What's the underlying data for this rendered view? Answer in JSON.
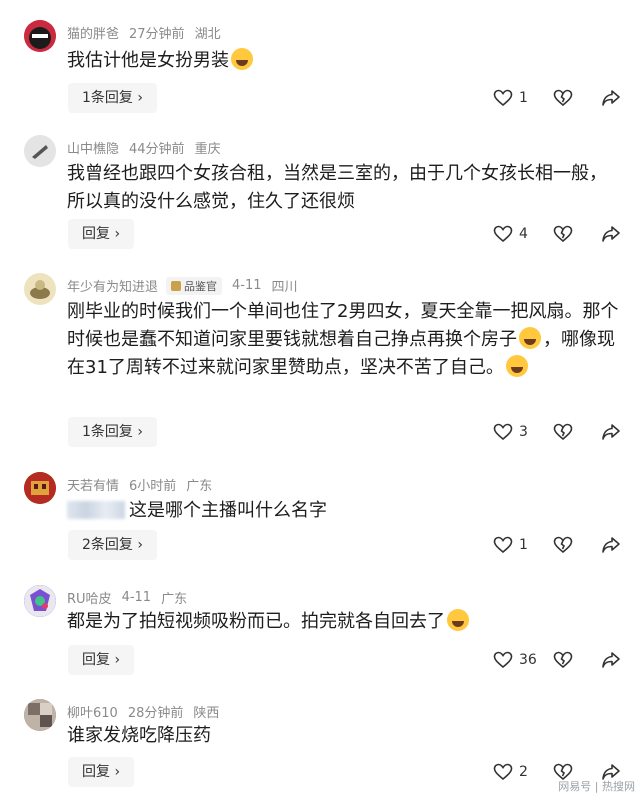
{
  "comments": [
    {
      "user": "猫的胖爸",
      "time": "27分钟前",
      "location": "湖北",
      "text": "我估计他是女扮男装",
      "emoji_after": true,
      "reply_label": "1条回复 ›",
      "likes": "1"
    },
    {
      "user": "山中樵隐",
      "time": "44分钟前",
      "location": "重庆",
      "text": "我曾经也跟四个女孩合租，当然是三室的，由于几个女孩长相一般，所以真的没什么感觉，住久了还很烦",
      "reply_label": "回复 ›",
      "likes": "4"
    },
    {
      "user": "年少有为知进退",
      "badge": "品鉴官",
      "time": "4-11",
      "location": "四川",
      "text_a": "刚毕业的时候我们一个单间也住了2男四女，夏天全靠一把风扇。那个时候也是蠢不知道问家里要钱就想着自己挣点再换个房子",
      "text_b": "，哪像现在31了周转不过来就问家里赞助点，坚决不苦了自己。",
      "reply_label": "1条回复 ›",
      "likes": "3"
    },
    {
      "user": "天若有情",
      "time": "6小时前",
      "location": "广东",
      "text": "这是哪个主播叫什么名字",
      "reply_label": "2条回复 ›",
      "likes": "1"
    },
    {
      "user": "RU哈皮",
      "time": "4-11",
      "location": "广东",
      "text": "都是为了拍短视频吸粉而已。拍完就各自回去了",
      "reply_label": "回复 ›",
      "likes": "36"
    },
    {
      "user": "柳叶610",
      "time": "28分钟前",
      "location": "陕西",
      "text": "谁家发烧吃降压药",
      "reply_label": "回复 ›",
      "likes": "2"
    }
  ],
  "watermark": "网易号 | 热搜网",
  "icons": {
    "like": "heart-icon",
    "dislike": "broken-heart-icon",
    "share": "share-arrow-icon"
  },
  "colors": {
    "meta": "#8a8a8a",
    "text": "#1d1d1d",
    "reply_bg": "#f5f5f5"
  }
}
